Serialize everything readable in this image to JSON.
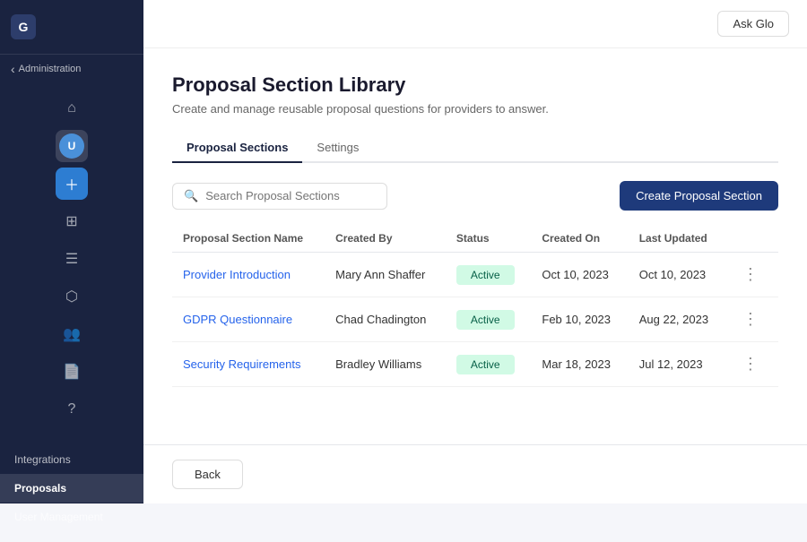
{
  "sidebar": {
    "logo_letter": "G",
    "back_label": "Administration",
    "nav_items": [
      {
        "id": "integrations",
        "label": "Integrations",
        "active": false
      },
      {
        "id": "proposals",
        "label": "Proposals",
        "active": true
      },
      {
        "id": "user-management",
        "label": "User Management",
        "active": false
      }
    ]
  },
  "topbar": {
    "ask_glo_label": "Ask Glo"
  },
  "page": {
    "title": "Proposal Section Library",
    "subtitle": "Create and manage reusable proposal questions for providers to answer."
  },
  "tabs": [
    {
      "id": "proposal-sections",
      "label": "Proposal Sections",
      "active": true
    },
    {
      "id": "settings",
      "label": "Settings",
      "active": false
    }
  ],
  "search": {
    "placeholder": "Search Proposal Sections"
  },
  "create_button_label": "Create Proposal Section",
  "table": {
    "headers": [
      "Proposal Section Name",
      "Created By",
      "Status",
      "Created On",
      "Last Updated"
    ],
    "rows": [
      {
        "name": "Provider Introduction",
        "created_by": "Mary Ann Shaffer",
        "status": "Active",
        "created_on": "Oct 10, 2023",
        "last_updated": "Oct 10, 2023"
      },
      {
        "name": "GDPR Questionnaire",
        "created_by": "Chad Chadington",
        "status": "Active",
        "created_on": "Feb 10, 2023",
        "last_updated": "Aug 22, 2023"
      },
      {
        "name": "Security Requirements",
        "created_by": "Bradley Williams",
        "status": "Active",
        "created_on": "Mar 18, 2023",
        "last_updated": "Jul 12, 2023"
      }
    ]
  },
  "back_button_label": "Back"
}
